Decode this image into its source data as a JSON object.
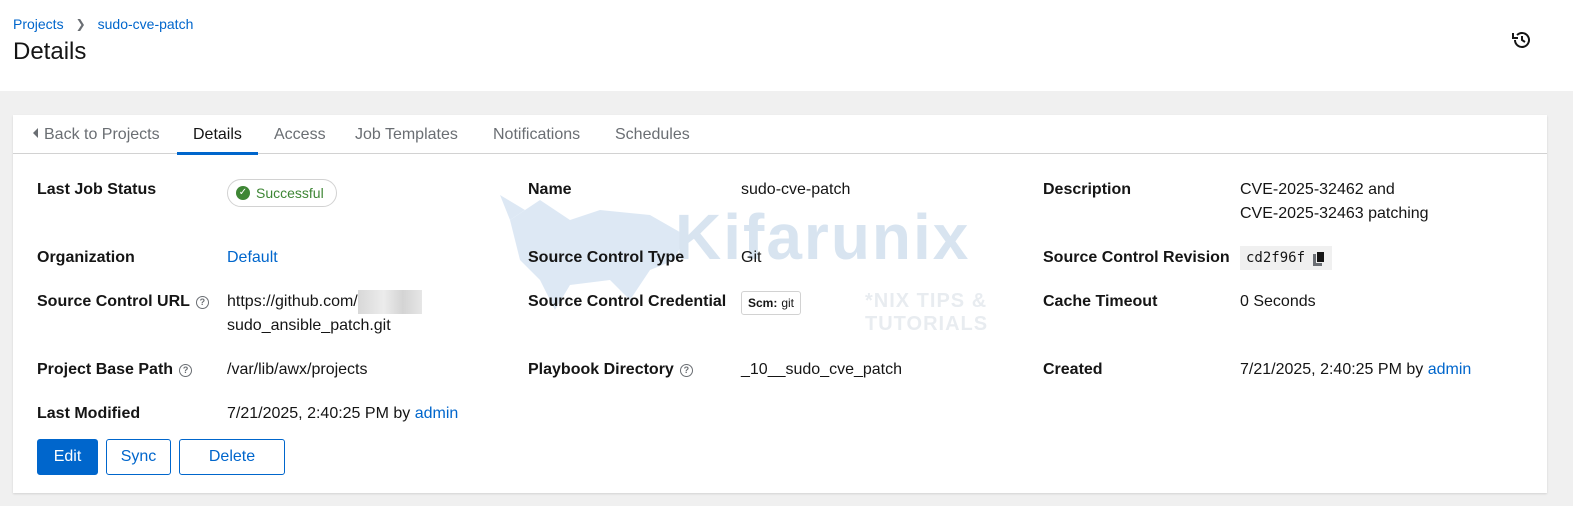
{
  "breadcrumb": {
    "projects": "Projects",
    "current": "sudo-cve-patch"
  },
  "page": {
    "title": "Details"
  },
  "tabs": {
    "back": "Back to Projects",
    "details": "Details",
    "access": "Access",
    "job_templates": "Job Templates",
    "notifications": "Notifications",
    "schedules": "Schedules"
  },
  "details": {
    "last_job_status": {
      "label": "Last Job Status",
      "value": "Successful"
    },
    "name": {
      "label": "Name",
      "value": "sudo-cve-patch"
    },
    "description": {
      "label": "Description",
      "line1": "CVE-2025-32462 and",
      "line2": "CVE-2025-32463 patching"
    },
    "organization": {
      "label": "Organization",
      "value": "Default"
    },
    "source_control_type": {
      "label": "Source Control Type",
      "value": "Git"
    },
    "source_control_revision": {
      "label": "Source Control Revision",
      "value": "cd2f96f"
    },
    "source_control_url": {
      "label": "Source Control URL",
      "line1": "https://github.com/",
      "line2": "sudo_ansible_patch.git"
    },
    "source_control_credential": {
      "label": "Source Control Credential",
      "type": "Scm:",
      "value": "git"
    },
    "cache_timeout": {
      "label": "Cache Timeout",
      "value": "0 Seconds"
    },
    "project_base_path": {
      "label": "Project Base Path",
      "value": "/var/lib/awx/projects"
    },
    "playbook_directory": {
      "label": "Playbook Directory",
      "value": "_10__sudo_cve_patch"
    },
    "created": {
      "label": "Created",
      "date": "7/21/2025, 2:40:25 PM by",
      "user": "admin"
    },
    "last_modified": {
      "label": "Last Modified",
      "date": "7/21/2025, 2:40:25 PM by",
      "user": "admin"
    }
  },
  "actions": {
    "edit": "Edit",
    "sync": "Sync",
    "delete": "Delete"
  },
  "watermark": {
    "brand": "Kifarunix",
    "tagline": "*NIX TIPS & TUTORIALS"
  },
  "colors": {
    "link": "#0066cc",
    "success": "#3e8635",
    "primary": "#0066cc"
  }
}
